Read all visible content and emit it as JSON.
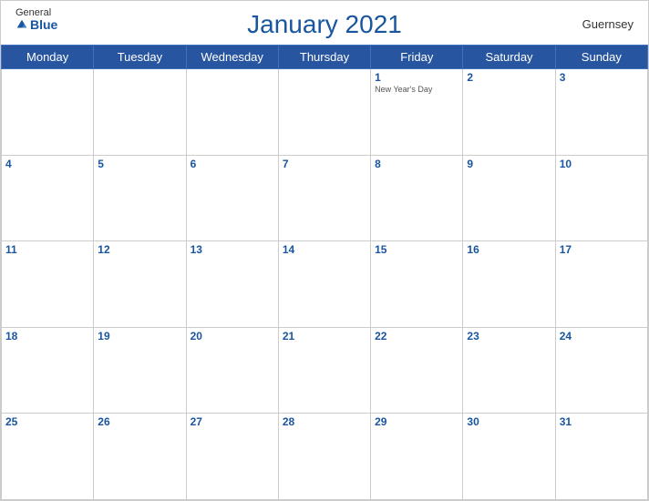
{
  "header": {
    "logo": {
      "general": "General",
      "blue": "Blue"
    },
    "title": "January 2021",
    "country": "Guernsey"
  },
  "weekdays": [
    "Monday",
    "Tuesday",
    "Wednesday",
    "Thursday",
    "Friday",
    "Saturday",
    "Sunday"
  ],
  "weeks": [
    [
      {
        "day": null
      },
      {
        "day": null
      },
      {
        "day": null
      },
      {
        "day": null
      },
      {
        "day": 1,
        "holiday": "New Year's Day"
      },
      {
        "day": 2
      },
      {
        "day": 3
      }
    ],
    [
      {
        "day": 4
      },
      {
        "day": 5
      },
      {
        "day": 6
      },
      {
        "day": 7
      },
      {
        "day": 8
      },
      {
        "day": 9
      },
      {
        "day": 10
      }
    ],
    [
      {
        "day": 11
      },
      {
        "day": 12
      },
      {
        "day": 13
      },
      {
        "day": 14
      },
      {
        "day": 15
      },
      {
        "day": 16
      },
      {
        "day": 17
      }
    ],
    [
      {
        "day": 18
      },
      {
        "day": 19
      },
      {
        "day": 20
      },
      {
        "day": 21
      },
      {
        "day": 22
      },
      {
        "day": 23
      },
      {
        "day": 24
      }
    ],
    [
      {
        "day": 25
      },
      {
        "day": 26
      },
      {
        "day": 27
      },
      {
        "day": 28
      },
      {
        "day": 29
      },
      {
        "day": 30
      },
      {
        "day": 31
      }
    ]
  ],
  "colors": {
    "header_bg": "#2855a0",
    "day_number": "#1a56a0",
    "title": "#1a56a0"
  }
}
